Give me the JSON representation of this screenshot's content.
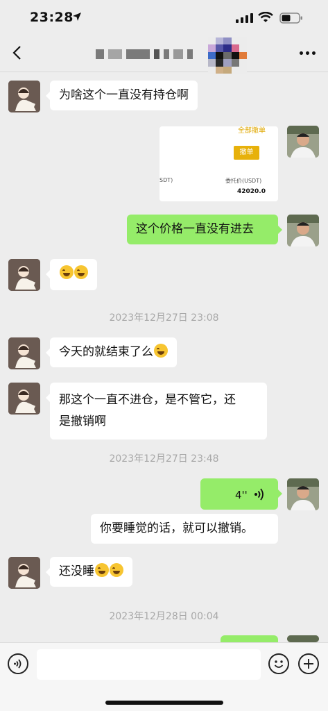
{
  "status_bar": {
    "time": "23:28"
  },
  "nav": {
    "icons": [
      "back-icon",
      "more-icon"
    ]
  },
  "messages": {
    "m1": "为啥这个一直没有持仓啊",
    "card": {
      "top_text": "全部撤单",
      "cancel": "撤单",
      "label_left": "SDT)",
      "label_right": "委托价(USDT)",
      "value": "42020.0"
    },
    "m2": "这个价格一直没有进去",
    "ts1": "2023年12月27日 23:08",
    "m3": "今天的就结束了么",
    "m4_line1": "那这个一直不进仓，是不管它，还",
    "m4_line2": "是撤销啊",
    "ts2": "2023年12月27日 23:48",
    "voice_duration": "4''",
    "m5": "你要睡觉的话，就可以撤销。",
    "m6": "还没睡",
    "ts3": "2023年12月28日 00:04"
  },
  "colors": {
    "sent_bubble": "#95ec69",
    "received_bubble": "#ffffff",
    "background": "#ededed"
  }
}
